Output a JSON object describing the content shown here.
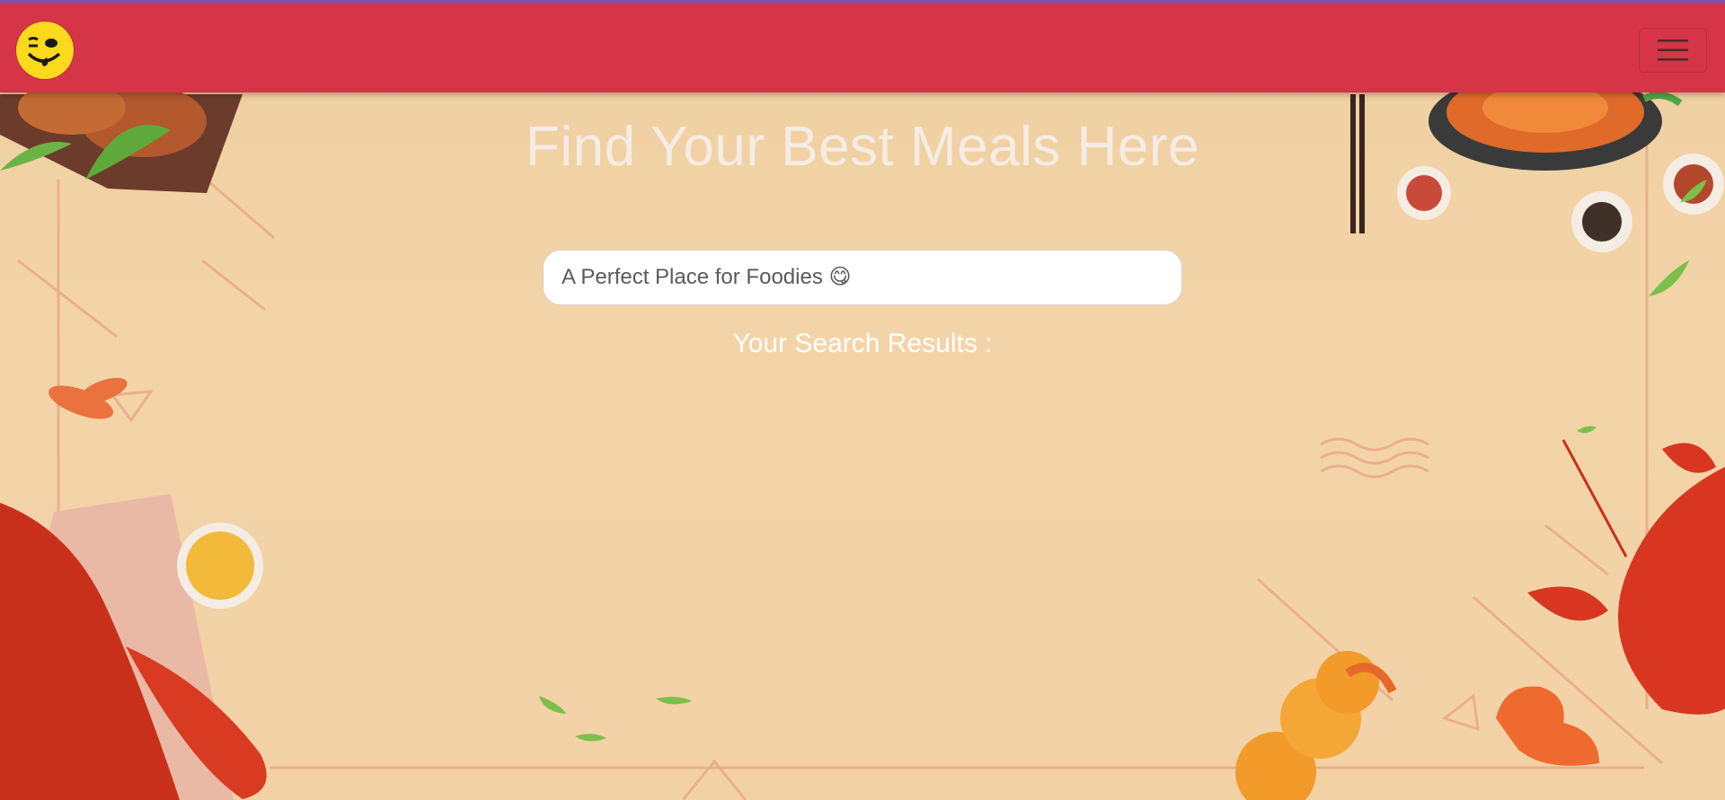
{
  "navbar": {
    "logo_icon": "smiling-face-logo-icon",
    "menu_icon": "hamburger-menu-icon",
    "brand_color": "#d63447",
    "logo_color": "#fcd91c"
  },
  "hero": {
    "title": "Find Your Best Meals Here"
  },
  "search": {
    "placeholder": "A Perfect Place for Foodies 😋",
    "value": ""
  },
  "results": {
    "label": "Your Search Results :"
  },
  "background": {
    "theme": "seafood-illustration",
    "color": "#f3d3a6"
  }
}
